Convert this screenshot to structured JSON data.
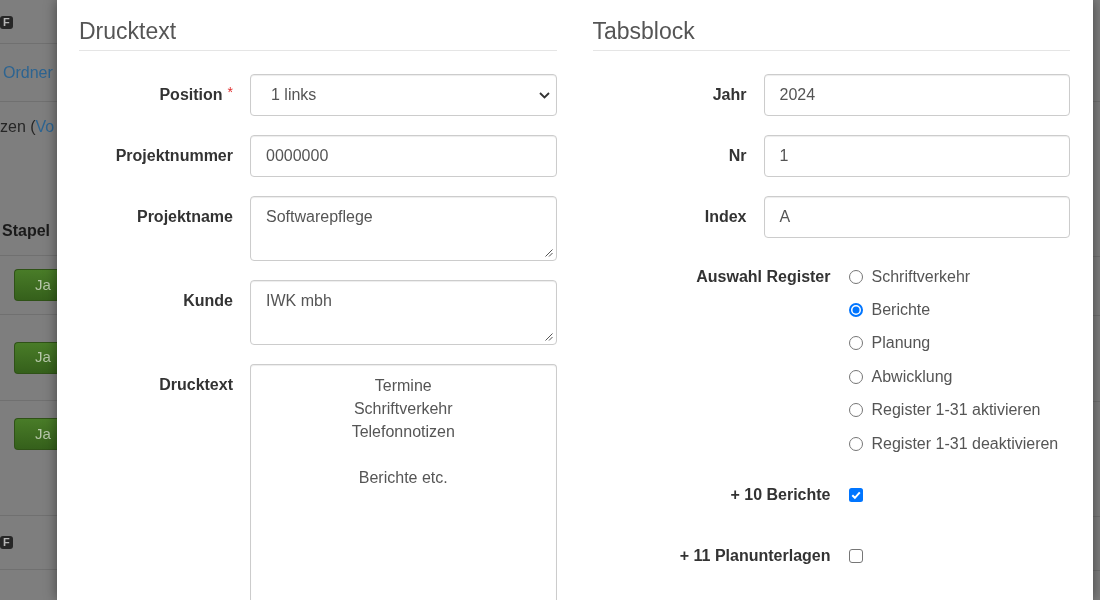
{
  "background_page": {
    "top_badge": "F",
    "folder_link": "Ordner",
    "note": {
      "text": "zen (",
      "link": "Vo"
    },
    "column_header": "Stapel",
    "rows": [
      {
        "button": "Ja"
      },
      {
        "button": "Ja"
      },
      {
        "button": "Ja"
      }
    ],
    "bottom_badge": "F"
  },
  "dialog": {
    "sections": [
      {
        "title": "Drucktext",
        "fields": [
          {
            "kind": "select",
            "label": "Position",
            "required_mark": "*",
            "value": "1 links"
          },
          {
            "kind": "input",
            "label": "Projektnummer",
            "value": "0000000"
          },
          {
            "kind": "textarea",
            "label": "Projektname",
            "value": "Softwarepflege"
          },
          {
            "kind": "textarea",
            "label": "Kunde",
            "value": "IWK mbh"
          },
          {
            "kind": "print_text",
            "label": "Drucktext",
            "value": "Termine\nSchriftverkehr\nTelefonnotizen\n\nBerichte etc."
          }
        ]
      },
      {
        "title": "Tabsblock",
        "fields": [
          {
            "kind": "input",
            "label": "Jahr",
            "value": "2024"
          },
          {
            "kind": "input",
            "label": "Nr",
            "value": "1"
          },
          {
            "kind": "input",
            "label": "Index",
            "value": "A"
          },
          {
            "kind": "radio_group",
            "label": "Auswahl Register",
            "options": [
              {
                "label": "Schriftverkehr",
                "selected": false
              },
              {
                "label": "Berichte",
                "selected": true
              },
              {
                "label": "Planung",
                "selected": false
              },
              {
                "label": "Abwicklung",
                "selected": false
              },
              {
                "label": "Register 1-31 aktivieren",
                "selected": false
              },
              {
                "label": "Register 1-31 deaktivieren",
                "selected": false
              }
            ]
          },
          {
            "kind": "checkbox",
            "label": "+ 10 Berichte",
            "checked": true
          },
          {
            "kind": "checkbox",
            "label": "+ 11 Planunterlagen",
            "checked": false
          }
        ]
      }
    ]
  }
}
